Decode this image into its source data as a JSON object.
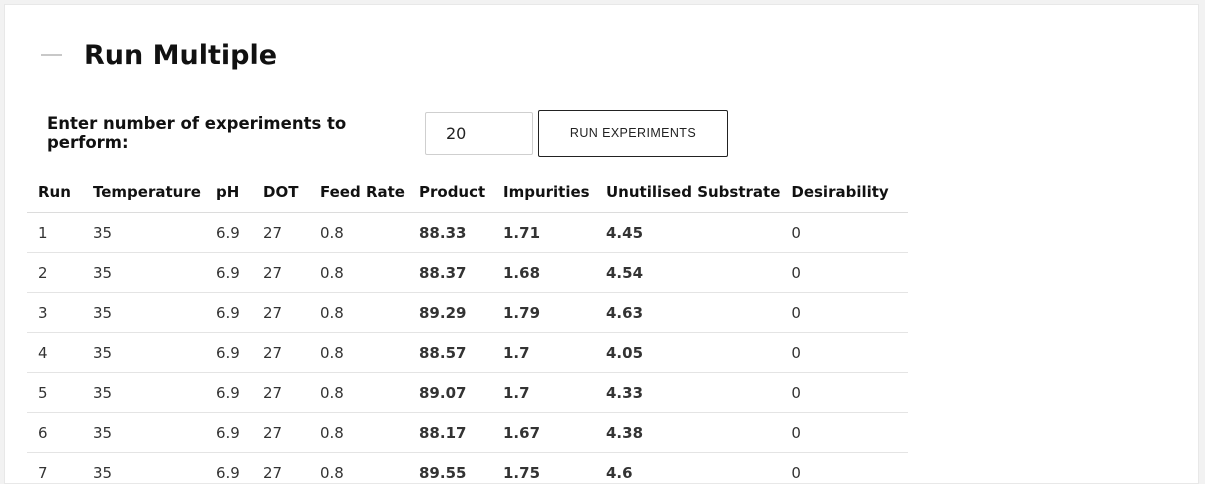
{
  "panel": {
    "title": "Run Multiple",
    "collapse_icon": "minus-icon"
  },
  "controls": {
    "label": "Enter number of experiments to perform:",
    "experiments_value": "20",
    "run_button_label": "RUN EXPERIMENTS"
  },
  "colors": {
    "product": "#d97a1e",
    "impurities": "#1a9c1a",
    "substrate": "#a01010"
  },
  "table": {
    "headers": [
      "Run",
      "Temperature",
      "pH",
      "DOT",
      "Feed Rate",
      "Product",
      "Impurities",
      "Unutilised Substrate",
      "Desirability"
    ],
    "rows": [
      [
        "1",
        "35",
        "6.9",
        "27",
        "0.8",
        "88.33",
        "1.71",
        "4.45",
        "0"
      ],
      [
        "2",
        "35",
        "6.9",
        "27",
        "0.8",
        "88.37",
        "1.68",
        "4.54",
        "0"
      ],
      [
        "3",
        "35",
        "6.9",
        "27",
        "0.8",
        "89.29",
        "1.79",
        "4.63",
        "0"
      ],
      [
        "4",
        "35",
        "6.9",
        "27",
        "0.8",
        "88.57",
        "1.7",
        "4.05",
        "0"
      ],
      [
        "5",
        "35",
        "6.9",
        "27",
        "0.8",
        "89.07",
        "1.7",
        "4.33",
        "0"
      ],
      [
        "6",
        "35",
        "6.9",
        "27",
        "0.8",
        "88.17",
        "1.67",
        "4.38",
        "0"
      ],
      [
        "7",
        "35",
        "6.9",
        "27",
        "0.8",
        "89.55",
        "1.75",
        "4.6",
        "0"
      ]
    ]
  }
}
